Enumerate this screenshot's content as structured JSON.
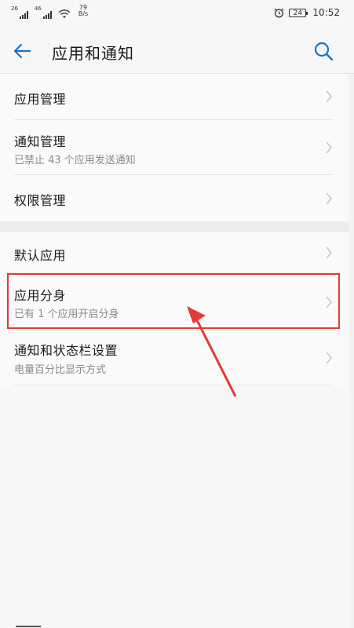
{
  "status_bar": {
    "network_1": "26",
    "network_2": "46",
    "speed_value": "79",
    "speed_unit": "B/s",
    "battery": "24",
    "time": "10:52"
  },
  "app_bar": {
    "title": "应用和通知"
  },
  "list": {
    "items": [
      {
        "title": "应用管理",
        "subtitle": ""
      },
      {
        "title": "通知管理",
        "subtitle": "已禁止 43 个应用发送通知"
      },
      {
        "title": "权限管理",
        "subtitle": ""
      },
      {
        "title": "默认应用",
        "subtitle": ""
      },
      {
        "title": "应用分身",
        "subtitle": "已有 1 个应用开启分身"
      },
      {
        "title": "通知和状态栏设置",
        "subtitle": "电量百分比显示方式"
      }
    ]
  },
  "colors": {
    "accent": "#1a73c8",
    "highlight": "#e53935"
  }
}
